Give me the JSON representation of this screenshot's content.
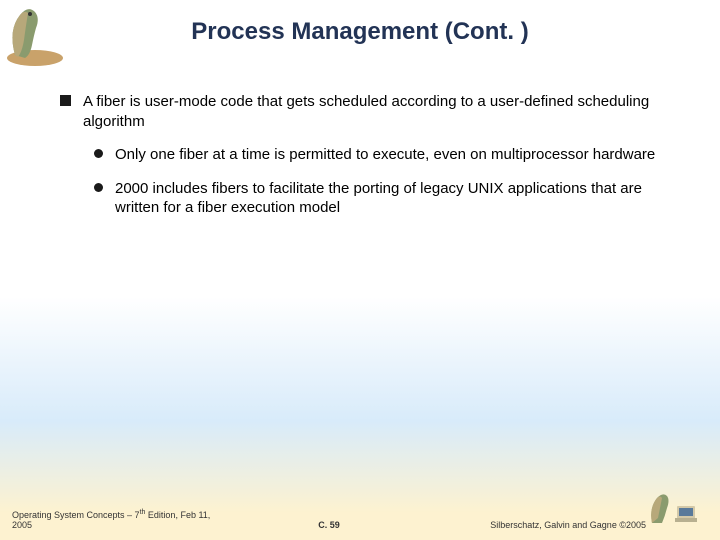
{
  "title": "Process Management (Cont. )",
  "bullets": {
    "b1": "A fiber is user-mode code that gets scheduled according to a user-defined scheduling algorithm",
    "b1a": "Only one fiber at a time is permitted to execute, even on multiprocessor hardware",
    "b1b": "2000 includes fibers to facilitate the porting of legacy UNIX applications that are written for a fiber execution model"
  },
  "footer": {
    "left_a": "Operating System Concepts – 7",
    "left_b": " Edition, Feb 11, 2005",
    "left_sup": "th",
    "center": "C. 59",
    "right": "Silberschatz, Galvin and Gagne ©2005"
  }
}
